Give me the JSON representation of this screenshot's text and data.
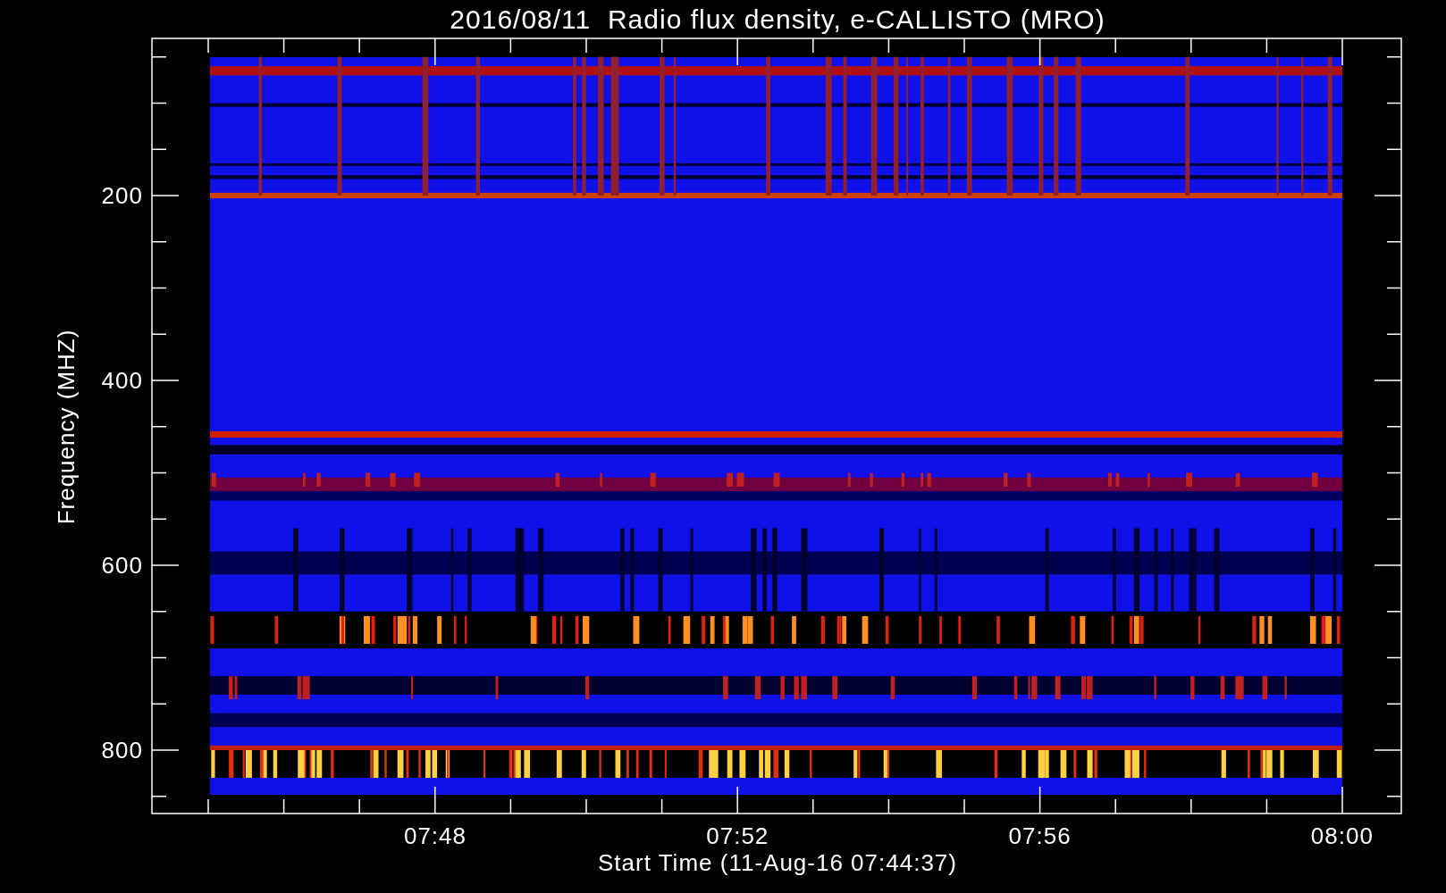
{
  "title": "2016/08/11  Radio flux density, e-CALLISTO (MRO)",
  "y_axis": {
    "label": "Frequency (MHZ)",
    "ticks": [
      "200",
      "400",
      "600",
      "800"
    ]
  },
  "x_axis": {
    "label": "Start Time (11-Aug-16 07:44:37)",
    "ticks": [
      "07:48",
      "07:52",
      "07:56",
      "08:00"
    ]
  }
}
